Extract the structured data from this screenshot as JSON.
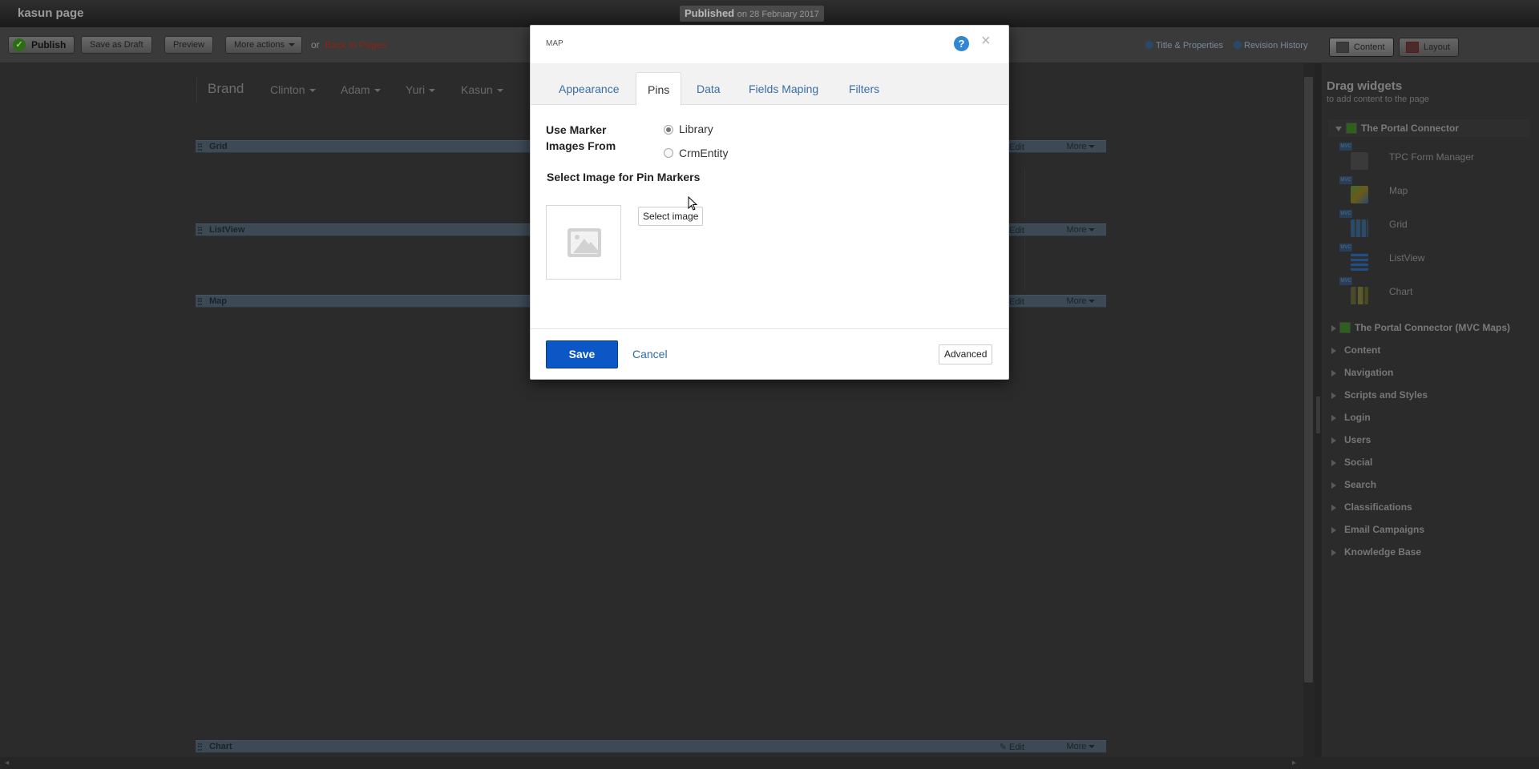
{
  "topbar": {
    "site_title": "kasun page",
    "status": "Published",
    "status_date": "on 28 February 2017"
  },
  "toolbar": {
    "publish": "Publish",
    "save_draft": "Save as Draft",
    "preview": "Preview",
    "more_actions": "More actions",
    "or": "or",
    "back": "Back to Pages",
    "title_properties": "Title & Properties",
    "revision_history": "Revision History",
    "content": "Content",
    "layout": "Layout"
  },
  "page": {
    "nav": {
      "brand": "Brand",
      "items": [
        "Clinton",
        "Adam",
        "Yuri",
        "Kasun"
      ]
    },
    "widgets": [
      {
        "title": "Grid",
        "edit": "Edit",
        "more": "More"
      },
      {
        "title": "ListView",
        "edit": "Edit",
        "more": "More"
      },
      {
        "title": "Map",
        "edit": "Edit",
        "more": "More"
      },
      {
        "title": "Chart",
        "edit": "Edit",
        "more": "More"
      }
    ]
  },
  "panel": {
    "title": "Drag widgets",
    "subtitle": "to add content to the page",
    "open_group": "The Portal Connector",
    "open_group_items": [
      "TPC Form Manager",
      "Map",
      "Grid",
      "ListView",
      "Chart"
    ],
    "mvc_badge": "MVC",
    "mvc_group": "The Portal Connector (MVC Maps)",
    "categories": [
      "Content",
      "Navigation",
      "Scripts and Styles",
      "Login",
      "Users",
      "Social",
      "Search",
      "Classifications",
      "Email Campaigns",
      "Knowledge Base"
    ]
  },
  "modal": {
    "title": "MAP",
    "help": "?",
    "close": "×",
    "tabs": [
      "Appearance",
      "Pins",
      "Data",
      "Fields Maping",
      "Filters"
    ],
    "active_tab": "Pins",
    "use_marker_label": "Use Marker Images From",
    "radio_options": [
      "Library",
      "CrmEntity"
    ],
    "selected_option": "Library",
    "select_image_label": "Select Image for Pin Markers",
    "select_image_button": "Select image",
    "save": "Save",
    "cancel": "Cancel",
    "advanced": "Advanced"
  },
  "colors": {
    "accent": "#0b57c6",
    "link": "#2e6da4",
    "help": "#2f87d6",
    "widget_bar": "#3d4a56"
  }
}
